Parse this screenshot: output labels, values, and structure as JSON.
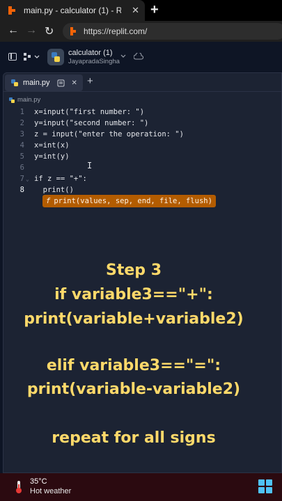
{
  "browser": {
    "tab_title": "main.py - calculator (1) - Replit",
    "url": "https://replit.com/"
  },
  "repl": {
    "project_name": "calculator (1)",
    "owner": "JayapradaSingha"
  },
  "editor": {
    "tab_label": "main.py",
    "breadcrumb": "main.py",
    "lines": [
      {
        "n": "1",
        "text": "x=input(\"first number: \")"
      },
      {
        "n": "2",
        "text": "y=input(\"second number: \")"
      },
      {
        "n": "3",
        "text": "z = input(\"enter the operation: \")"
      },
      {
        "n": "4",
        "text": "x=int(x)"
      },
      {
        "n": "5",
        "text": "y=int(y)"
      },
      {
        "n": "6",
        "text": ""
      },
      {
        "n": "7",
        "text": "if z == \"+\":"
      },
      {
        "n": "8",
        "text": "  print()"
      }
    ],
    "signature_hint": "print(values, sep, end, file, flush)",
    "signature_icon": "f"
  },
  "caption": {
    "line1": "Step 3",
    "line2": "if variable3==\"+\":",
    "line3": "print(variable+variable2)",
    "line4": "elif variable3==\"=\":",
    "line5": "print(variable-variable2)",
    "line6": "repeat for all signs"
  },
  "taskbar": {
    "temperature": "35°C",
    "weather": "Hot weather"
  },
  "colors": {
    "caption": "#ffd96a",
    "signature_bg": "#b35c00",
    "editor_bg": "#1c2333",
    "taskbar_bg": "#2b0a10"
  }
}
